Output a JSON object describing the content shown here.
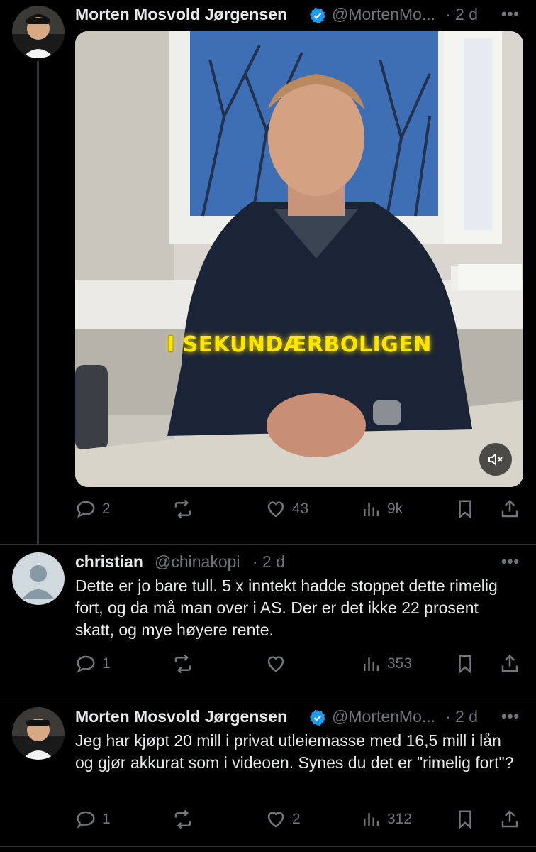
{
  "tweets": [
    {
      "author": "Morten Mosvold Jørgensen",
      "handle": "@MortenMo...",
      "time": "· 2 d",
      "verified": true,
      "media_overlay_text": "I SEKUNDÆRBOLIGEN",
      "actions": {
        "replies": "2",
        "reposts": "",
        "likes": "43",
        "views": "9k"
      }
    },
    {
      "author": "christian",
      "handle": "@chinakopi",
      "time": "· 2 d",
      "verified": false,
      "text": "Dette er jo bare tull. 5 x inntekt hadde stoppet dette rimelig fort, og da må man over i AS. Der er det ikke 22 prosent skatt, og mye høyere rente.",
      "actions": {
        "replies": "1",
        "reposts": "",
        "likes": "",
        "views": "353"
      }
    },
    {
      "author": "Morten Mosvold Jørgensen",
      "handle": "@MortenMo...",
      "time": "· 2 d",
      "verified": true,
      "text": "Jeg har kjøpt 20 mill i privat utleiemasse med 16,5 mill i lån og gjør akkurat som i videoen. Synes du det er \"rimelig fort\"?",
      "actions": {
        "replies": "1",
        "reposts": "",
        "likes": "2",
        "views": "312"
      }
    }
  ],
  "more_label": "•••",
  "colors": {
    "accent": "#1d9bf0",
    "muted": "#71767b",
    "background": "#000000",
    "overlay_text": "#ffe600"
  },
  "icons": [
    "reply-icon",
    "repost-icon",
    "like-icon",
    "views-icon",
    "bookmark-icon",
    "share-icon",
    "mute-icon",
    "verified-icon"
  ]
}
